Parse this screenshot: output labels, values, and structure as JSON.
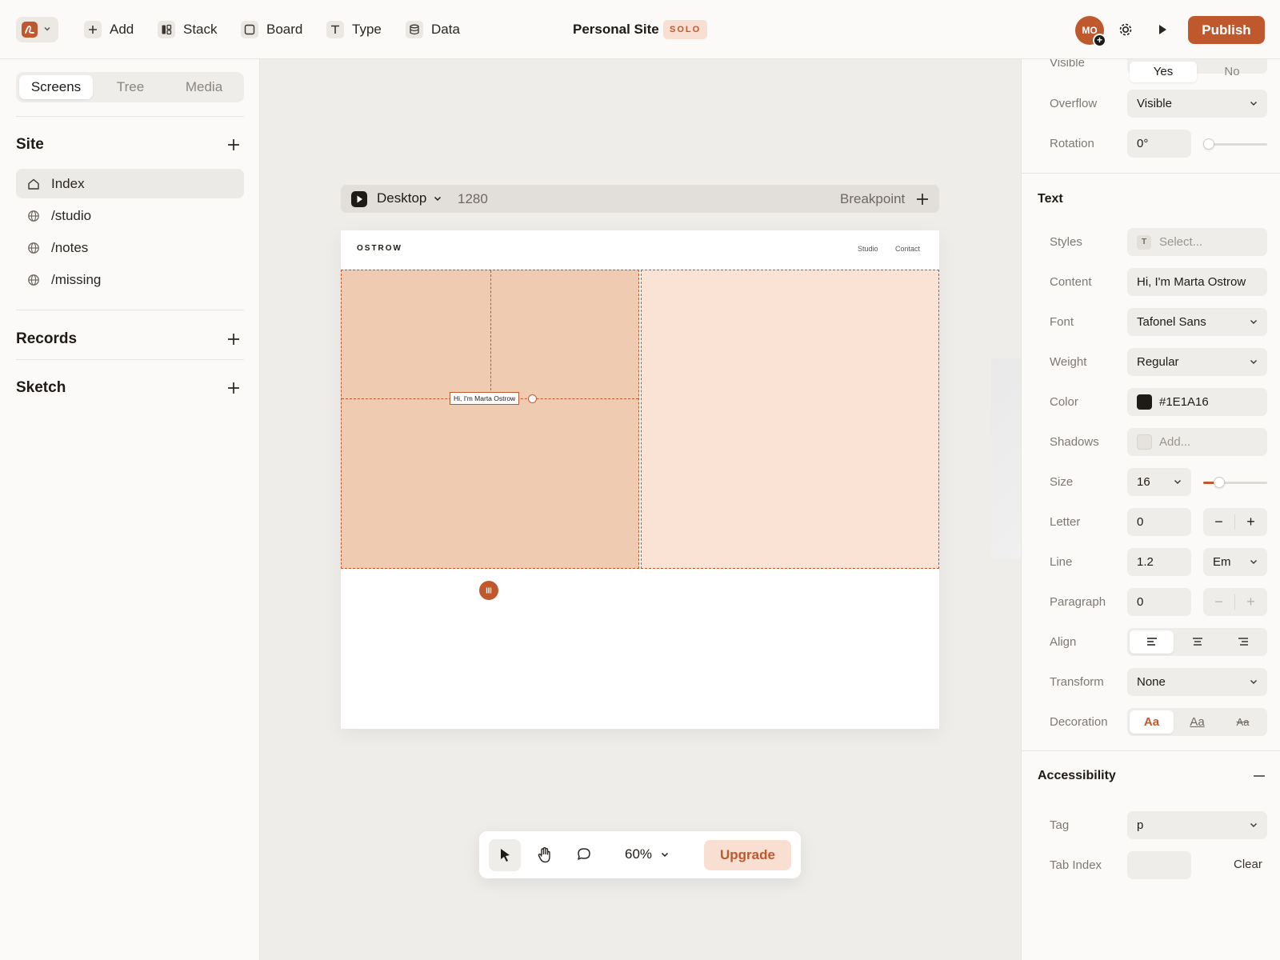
{
  "toolbar": {
    "tools": [
      {
        "label": "Add",
        "icon": "plus-icon"
      },
      {
        "label": "Stack",
        "icon": "stack-icon"
      },
      {
        "label": "Board",
        "icon": "board-icon"
      },
      {
        "label": "Type",
        "icon": "type-icon"
      },
      {
        "label": "Data",
        "icon": "database-icon"
      }
    ],
    "site_title": "Personal Site",
    "plan_badge": "SOLO",
    "avatar_initials": "MO",
    "publish_label": "Publish",
    "accent_color": "#C0582E"
  },
  "sidebar": {
    "tabs": [
      "Screens",
      "Tree",
      "Media"
    ],
    "active_tab": "Screens",
    "site_section": "Site",
    "pages": [
      {
        "label": "Index",
        "icon": "home-icon",
        "active": true
      },
      {
        "label": "/studio",
        "icon": "globe-icon"
      },
      {
        "label": "/notes",
        "icon": "globe-icon"
      },
      {
        "label": "/missing",
        "icon": "globe-icon"
      }
    ],
    "records_section": "Records",
    "sketch_section": "Sketch"
  },
  "canvas": {
    "device": "Desktop",
    "width": "1280",
    "breakpoint_label": "Breakpoint",
    "frame": {
      "logo": "OSTROW",
      "nav": [
        "Studio",
        "Contact"
      ],
      "selected_text": "Hi, I'm Marta Ostrow",
      "hero_left_color": "#EFCBB1",
      "hero_right_color": "#FAE2D4"
    }
  },
  "bottom_toolbar": {
    "zoom": "60%",
    "upgrade_label": "Upgrade"
  },
  "properties": {
    "visible": {
      "label": "Visible",
      "options": [
        "Yes",
        "No"
      ],
      "selected": "Yes"
    },
    "overflow": {
      "label": "Overflow",
      "value": "Visible"
    },
    "rotation": {
      "label": "Rotation",
      "value": "0°",
      "slider": 0
    },
    "text_section": "Text",
    "styles": {
      "label": "Styles",
      "placeholder": "Select..."
    },
    "content": {
      "label": "Content",
      "value": "Hi, I'm Marta Ostrow"
    },
    "font": {
      "label": "Font",
      "value": "Tafonel Sans"
    },
    "weight": {
      "label": "Weight",
      "value": "Regular"
    },
    "color": {
      "label": "Color",
      "value": "#1E1A16"
    },
    "shadows": {
      "label": "Shadows",
      "placeholder": "Add..."
    },
    "size": {
      "label": "Size",
      "value": "16",
      "slider": 0.2
    },
    "letter": {
      "label": "Letter",
      "value": "0"
    },
    "line": {
      "label": "Line",
      "value": "1.2",
      "unit": "Em"
    },
    "paragraph": {
      "label": "Paragraph",
      "value": "0"
    },
    "align": {
      "label": "Align",
      "selected": "left"
    },
    "transform": {
      "label": "Transform",
      "value": "None"
    },
    "decoration": {
      "label": "Decoration",
      "options": [
        "Aa",
        "Aa",
        "Aa"
      ],
      "selected": 0
    },
    "accessibility_section": "Accessibility",
    "tag": {
      "label": "Tag",
      "value": "p"
    },
    "tab_index": {
      "label": "Tab Index",
      "value": "",
      "clear_label": "Clear"
    }
  }
}
